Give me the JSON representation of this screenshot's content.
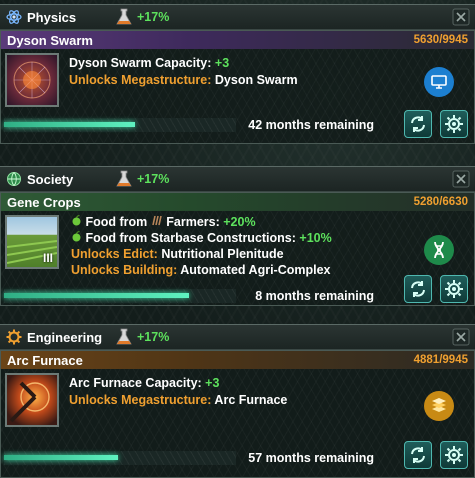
{
  "colors": {
    "boost_green": "#5de25d",
    "points_orange": "#f0a030",
    "progress_cyan": "#5ff2c0",
    "physics_purple": "#5a3a7a",
    "society_green": "#2f5a36",
    "engineering_orange": "#6a4418"
  },
  "sections": [
    {
      "category": "Physics",
      "category_icon": "atom-icon",
      "boost": "+17%",
      "tech": {
        "name": "Dyson Swarm",
        "points": "5630/9945",
        "progress": 0.566,
        "lines": [
          {
            "label": "Dyson Swarm Capacity:",
            "value": "+3"
          },
          {
            "label": "Unlocks Megastructure:",
            "value": "Dyson Swarm"
          }
        ],
        "remaining": "42 months remaining",
        "area_icon": "computer-icon"
      }
    },
    {
      "category": "Society",
      "category_icon": "globe-icon",
      "boost": "+17%",
      "tech": {
        "name": "Gene Crops",
        "points": "5280/6630",
        "progress": 0.796,
        "tier": "III",
        "lines": [
          {
            "icon": "food-icon",
            "label": "Food from",
            "icon2": "farmer-icon",
            "label2": "Farmers:",
            "value": "+20%"
          },
          {
            "icon": "food-icon",
            "label": "Food from Starbase Constructions:",
            "value": "+10%"
          },
          {
            "label": "Unlocks Edict:",
            "value": "Nutritional Plenitude"
          },
          {
            "label": "Unlocks Building:",
            "value": "Automated Agri-Complex"
          }
        ],
        "remaining": "8 months remaining",
        "area_icon": "dna-icon"
      }
    },
    {
      "category": "Engineering",
      "category_icon": "gear-icon",
      "boost": "+17%",
      "tech": {
        "name": "Arc Furnace",
        "points": "4881/9945",
        "progress": 0.491,
        "lines": [
          {
            "label": "Arc Furnace Capacity:",
            "value": "+3"
          },
          {
            "label": "Unlocks Megastructure:",
            "value": "Arc Furnace"
          }
        ],
        "remaining": "57 months remaining",
        "area_icon": "materials-icon"
      }
    }
  ]
}
